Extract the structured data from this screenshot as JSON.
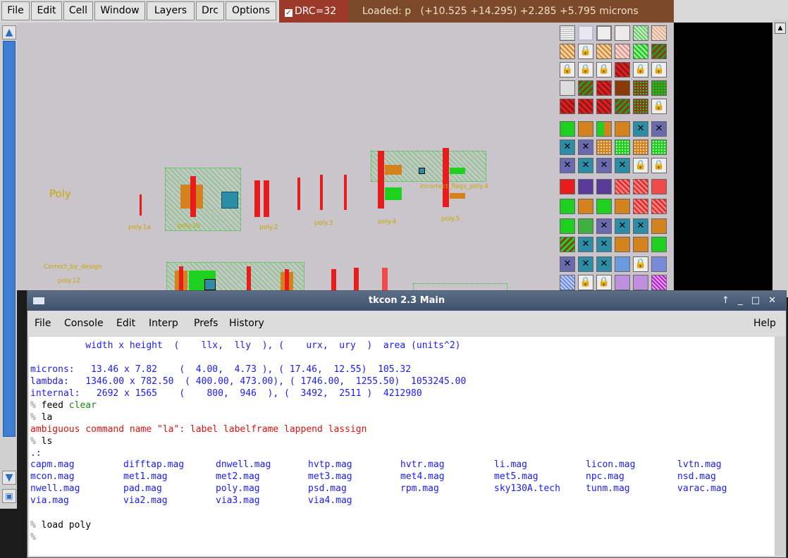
{
  "menubar": {
    "items": [
      "File",
      "Edit",
      "Cell",
      "Window",
      "Layers",
      "Drc",
      "Options"
    ],
    "drc_label": "DRC=32",
    "status": "Loaded: p   (+10.525 +14.295) +2.285 +5.795 microns"
  },
  "canvas": {
    "section_label": "Poly",
    "rule_labels": [
      "poly.1a",
      "poly.1b",
      "poly.2",
      "poly.3",
      "poly.4",
      "poly.5",
      "Incorrect_flags_poly.4",
      "Correct_by_design",
      "poly.12"
    ]
  },
  "colors": {
    "poly": "#e81c1c",
    "diff": "#1fd11f",
    "ndiff": "#d4821e",
    "contact": "#2c8ea6",
    "canvas": "#cac4cb",
    "drc": "#9b3a2a"
  },
  "tkcon": {
    "title": "tkcon 2.3 Main",
    "menu": [
      "File",
      "Console",
      "Edit",
      "Interp",
      "Prefs",
      "History"
    ],
    "help": "Help",
    "lines": {
      "header": "          width x height  (    llx,  lly  ), (    urx,  ury  )  area (units^2)",
      "microns": "microns:   13.46 x 7.82    (  4.00,  4.73 ), ( 17.46,  12.55)  105.32",
      "lambda": "lambda:   1346.00 x 782.50  ( 400.00, 473.00), ( 1746.00,  1255.50)  1053245.00",
      "internal": "internal:   2692 x 1565    (    800,  946  ), (  3492,  2511 )  4212980",
      "cmd1": "feed",
      "cmd1_arg": "clear",
      "cmd2": "la",
      "err": "ambiguous command name \"la\": label labelframe lappend lassign",
      "cmd3": "ls",
      "dot": ".:",
      "cmd4": "load",
      "cmd4_arg": "poly",
      "prompt": "%"
    },
    "files": [
      [
        "capm.mag",
        "difftap.mag",
        "dnwell.mag",
        "hvtp.mag",
        "hvtr.mag",
        "li.mag",
        "licon.mag",
        "lvtn.mag"
      ],
      [
        "mcon.mag",
        "met1.mag",
        "met2.mag",
        "met3.mag",
        "met4.mag",
        "met5.mag",
        "npc.mag",
        "nsd.mag"
      ],
      [
        "nwell.mag",
        "pad.mag",
        "poly.mag",
        "psd.mag",
        "rpm.mag",
        "sky130A.tech",
        "tunm.mag",
        "varac.mag"
      ],
      [
        "via.mag",
        "via2.mag",
        "via3.mag",
        "via4.mag",
        "",
        "",
        "",
        ""
      ]
    ]
  }
}
